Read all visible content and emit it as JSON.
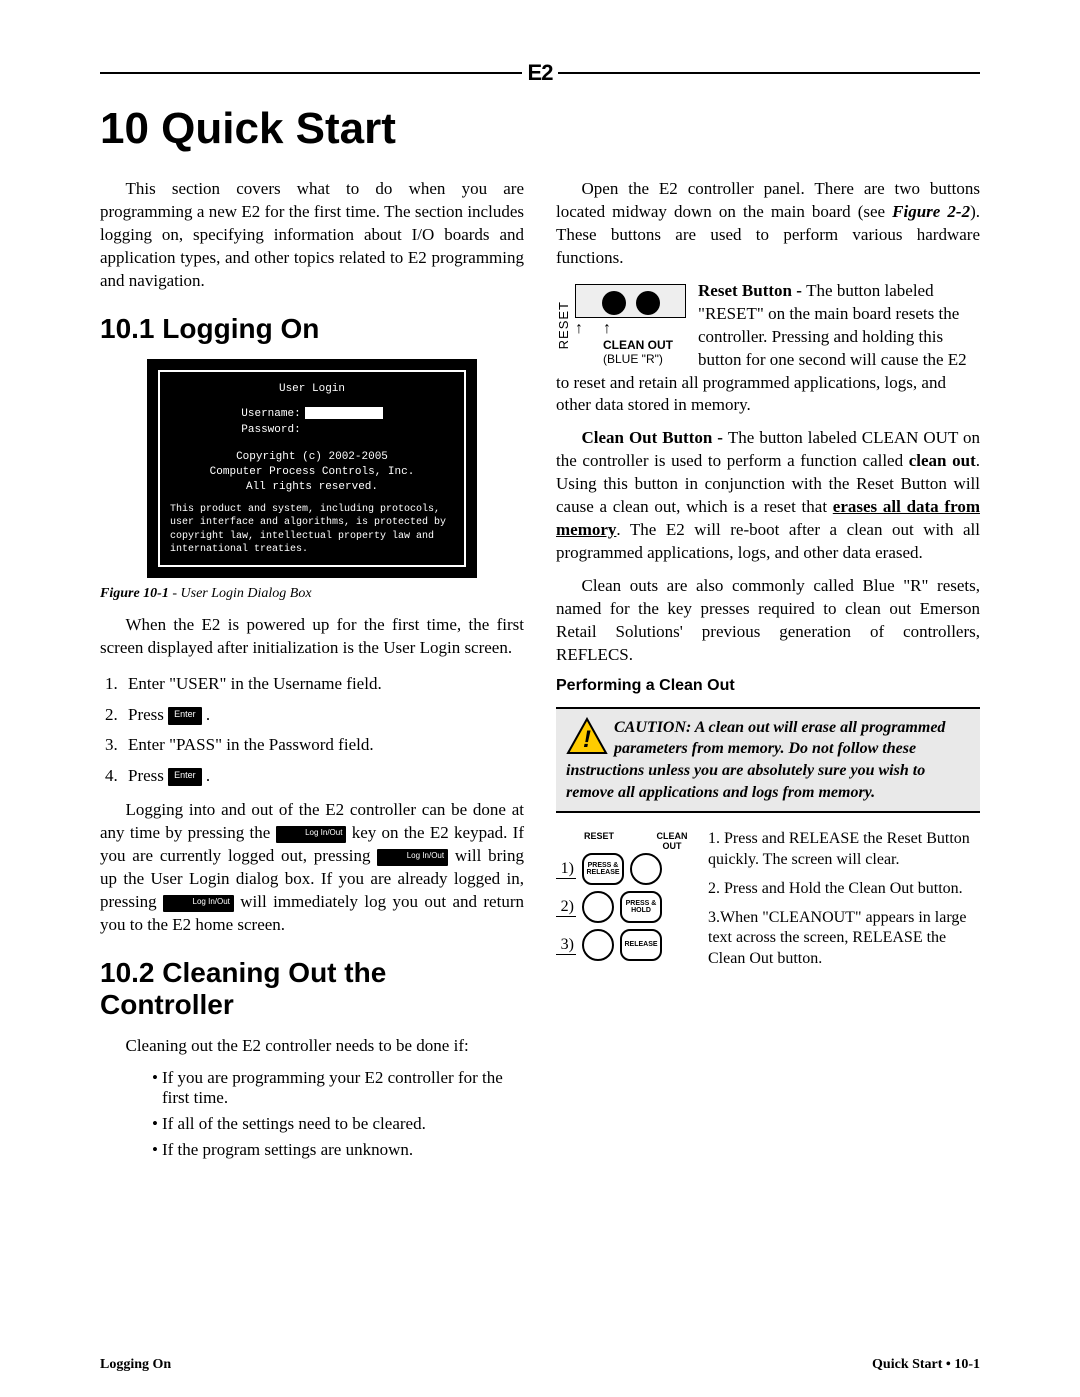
{
  "header_logo": "E2",
  "chapter_title": "10  Quick Start",
  "intro_para": "This section covers what to do when you are programming a new E2 for the first time. The section includes logging on, specifying information about I/O boards and application types, and other topics related to E2 programming and navigation.",
  "s10_1": {
    "title": "10.1  Logging On",
    "login_box": {
      "title": "User Login",
      "username_label": "Username:",
      "password_label": "Password:",
      "copyright1": "Copyright (c) 2002-2005",
      "copyright2": "Computer Process Controls, Inc.",
      "copyright3": "All rights reserved.",
      "legal": "This product and system, including protocols, user interface and algorithms, is protected by copyright law, intellectual property law and international treaties."
    },
    "fig_caption_b": "Figure 10-1",
    "fig_caption_i": " - User Login Dialog Box",
    "para1": "When the E2 is powered up for the first time, the first screen displayed after initialization is the User Login screen.",
    "steps": [
      "Enter \"USER\" in the Username field.",
      "Press ",
      "Enter \"PASS\" in the Password field.",
      "Press "
    ],
    "key_enter": "Enter",
    "key_loginout": "Log In/Out",
    "para2a": "Logging into and out of the E2 controller can be done at any time by pressing the ",
    "para2b": " key on the E2 keypad. If you are currently logged out, pressing ",
    "para2c": " will bring up the User Login dialog box. If you are already logged in, pressing ",
    "para2d": " will immediately log you out and return you to the E2 home screen."
  },
  "s10_2": {
    "title": "10.2  Cleaning Out the Controller",
    "lead": "Cleaning out the E2 controller needs to be done if:",
    "bullets": [
      "If you are programming your E2 controller for the first time.",
      "If all of the settings need to be cleared.",
      "If the program settings are unknown."
    ]
  },
  "right": {
    "open_para_a": "Open the E2 controller panel. There are two buttons located midway down on the main board (see ",
    "open_para_ref": "Figure 2-2",
    "open_para_b": "). These buttons are used to perform various hardware functions.",
    "diagram": {
      "reset_label": "RESET",
      "clean_label": "CLEAN OUT",
      "clean_sub": "(BLUE \"R\")"
    },
    "reset_head": "Reset Button - ",
    "reset_body": "The button labeled \"RESET\" on the main board resets the controller. Pressing and holding this button for one second will cause the E2 to reset and retain all programmed applications, logs, and other data stored in memory.",
    "clean_head": "Clean Out Button - ",
    "clean_p1a": "The button labeled CLEAN OUT on the controller is used to perform a function called ",
    "clean_p1_bold1": "clean out",
    "clean_p1b": ". Using this button in conjunction with the Reset Button will cause a clean out, which is a reset that ",
    "clean_p1_under": "erases all data from memory",
    "clean_p1c": ". The E2 will re-boot after a clean out with all programmed applications, logs, and other data erased.",
    "clean_p2": "Clean outs are also commonly called Blue \"R\" resets, named for the key presses required to clean out Emerson Retail Solutions' previous generation of controllers, REFLECS.",
    "perform_title": "Performing a Clean Out",
    "caution": "CAUTION: A clean out will erase all programmed parameters from memory. Do not follow these instructions unless you are absolutely sure you wish to remove all applications and logs from memory.",
    "co_head_reset": "RESET",
    "co_head_clean": "CLEAN OUT",
    "co_btn_pr": "PRESS & RELEASE",
    "co_btn_ph": "PRESS & HOLD",
    "co_btn_rel": "RELEASE",
    "co_steps": [
      "1. Press and RELEASE the Reset Button quickly. The screen will clear.",
      "2. Press and Hold the Clean Out button.",
      "3.When \"CLEANOUT\" appears in large text across the screen, RELEASE the Clean Out button."
    ]
  },
  "footer_left": "Logging On",
  "footer_right": "Quick Start • 10-1"
}
